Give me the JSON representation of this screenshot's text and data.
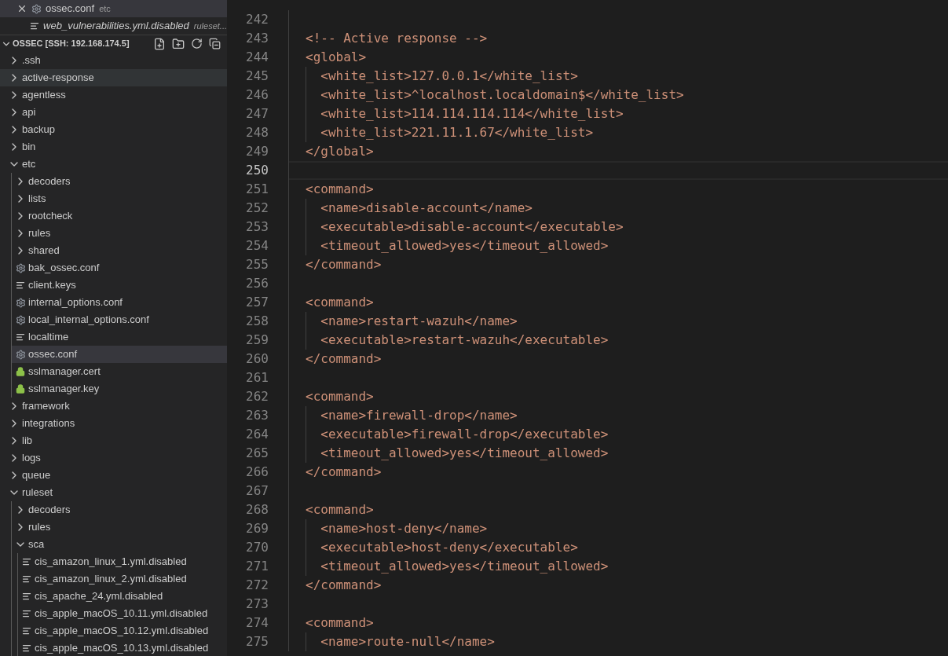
{
  "open_editors": [
    {
      "name": "ossec.conf",
      "description": "etc",
      "kind": "config",
      "selected": true,
      "preview": false,
      "closable": true
    },
    {
      "name": "web_vulnerabilities.yml.disabled",
      "description": "ruleset...",
      "kind": "text",
      "selected": false,
      "preview": true,
      "closable": false
    }
  ],
  "explorer": {
    "title": "OSSEC [SSH: 192.168.174.5]",
    "expanded": true,
    "items": [
      {
        "label": ".ssh",
        "kind": "folder",
        "expanded": false,
        "selected": false,
        "hovered": false
      },
      {
        "label": "active-response",
        "kind": "folder",
        "expanded": false,
        "selected": false,
        "hovered": true
      },
      {
        "label": "agentless",
        "kind": "folder",
        "expanded": false,
        "selected": false,
        "hovered": false
      },
      {
        "label": "api",
        "kind": "folder",
        "expanded": false,
        "selected": false,
        "hovered": false
      },
      {
        "label": "backup",
        "kind": "folder",
        "expanded": false,
        "selected": false,
        "hovered": false
      },
      {
        "label": "bin",
        "kind": "folder",
        "expanded": false,
        "selected": false,
        "hovered": false
      },
      {
        "label": "etc",
        "kind": "folder",
        "expanded": true,
        "selected": false,
        "hovered": false,
        "children": [
          {
            "label": "decoders",
            "kind": "folder",
            "expanded": false,
            "selected": false,
            "hovered": false
          },
          {
            "label": "lists",
            "kind": "folder",
            "expanded": false,
            "selected": false,
            "hovered": false
          },
          {
            "label": "rootcheck",
            "kind": "folder",
            "expanded": false,
            "selected": false,
            "hovered": false
          },
          {
            "label": "rules",
            "kind": "folder",
            "expanded": false,
            "selected": false,
            "hovered": false
          },
          {
            "label": "shared",
            "kind": "folder",
            "expanded": false,
            "selected": false,
            "hovered": false
          },
          {
            "label": "bak_ossec.conf",
            "kind": "config",
            "selected": false,
            "hovered": false
          },
          {
            "label": "client.keys",
            "kind": "text",
            "selected": false,
            "hovered": false
          },
          {
            "label": "internal_options.conf",
            "kind": "config",
            "selected": false,
            "hovered": false
          },
          {
            "label": "local_internal_options.conf",
            "kind": "config",
            "selected": false,
            "hovered": false
          },
          {
            "label": "localtime",
            "kind": "text",
            "selected": false,
            "hovered": false
          },
          {
            "label": "ossec.conf",
            "kind": "config",
            "selected": true,
            "hovered": false
          },
          {
            "label": "sslmanager.cert",
            "kind": "secure",
            "selected": false,
            "hovered": false
          },
          {
            "label": "sslmanager.key",
            "kind": "secure",
            "selected": false,
            "hovered": false
          }
        ]
      },
      {
        "label": "framework",
        "kind": "folder",
        "expanded": false,
        "selected": false,
        "hovered": false
      },
      {
        "label": "integrations",
        "kind": "folder",
        "expanded": false,
        "selected": false,
        "hovered": false
      },
      {
        "label": "lib",
        "kind": "folder",
        "expanded": false,
        "selected": false,
        "hovered": false
      },
      {
        "label": "logs",
        "kind": "folder",
        "expanded": false,
        "selected": false,
        "hovered": false
      },
      {
        "label": "queue",
        "kind": "folder",
        "expanded": false,
        "selected": false,
        "hovered": false
      },
      {
        "label": "ruleset",
        "kind": "folder",
        "expanded": true,
        "selected": false,
        "hovered": false,
        "children": [
          {
            "label": "decoders",
            "kind": "folder",
            "expanded": false,
            "selected": false,
            "hovered": false
          },
          {
            "label": "rules",
            "kind": "folder",
            "expanded": false,
            "selected": false,
            "hovered": false
          },
          {
            "label": "sca",
            "kind": "folder",
            "expanded": true,
            "selected": false,
            "hovered": false,
            "children": [
              {
                "label": "cis_amazon_linux_1.yml.disabled",
                "kind": "text",
                "selected": false,
                "hovered": false
              },
              {
                "label": "cis_amazon_linux_2.yml.disabled",
                "kind": "text",
                "selected": false,
                "hovered": false
              },
              {
                "label": "cis_apache_24.yml.disabled",
                "kind": "text",
                "selected": false,
                "hovered": false
              },
              {
                "label": "cis_apple_macOS_10.11.yml.disabled",
                "kind": "text",
                "selected": false,
                "hovered": false
              },
              {
                "label": "cis_apple_macOS_10.12.yml.disabled",
                "kind": "text",
                "selected": false,
                "hovered": false
              },
              {
                "label": "cis_apple_macOS_10.13.yml.disabled",
                "kind": "text",
                "selected": false,
                "hovered": false
              }
            ]
          }
        ]
      }
    ]
  },
  "editor": {
    "lines": [
      {
        "number": "242",
        "current": false
      },
      {
        "number": "243",
        "text": "<!-- Active response -->",
        "current": false
      },
      {
        "number": "244",
        "text": "<global>",
        "current": false
      },
      {
        "number": "245",
        "text": "  <white_list>127.0.0.1</white_list>",
        "current": false
      },
      {
        "number": "246",
        "text": "  <white_list>^localhost.localdomain$</white_list>",
        "current": false
      },
      {
        "number": "247",
        "text": "  <white_list>114.114.114.114</white_list>",
        "current": false
      },
      {
        "number": "248",
        "text": "  <white_list>221.11.1.67</white_list>",
        "current": false
      },
      {
        "number": "249",
        "text": "</global>",
        "current": false
      },
      {
        "number": "250",
        "current": true
      },
      {
        "number": "251",
        "text": "<command>",
        "current": false
      },
      {
        "number": "252",
        "text": "  <name>disable-account</name>",
        "current": false
      },
      {
        "number": "253",
        "text": "  <executable>disable-account</executable>",
        "current": false
      },
      {
        "number": "254",
        "text": "  <timeout_allowed>yes</timeout_allowed>",
        "current": false
      },
      {
        "number": "255",
        "text": "</command>",
        "current": false
      },
      {
        "number": "256",
        "current": false
      },
      {
        "number": "257",
        "text": "<command>",
        "current": false
      },
      {
        "number": "258",
        "text": "  <name>restart-wazuh</name>",
        "current": false
      },
      {
        "number": "259",
        "text": "  <executable>restart-wazuh</executable>",
        "current": false
      },
      {
        "number": "260",
        "text": "</command>",
        "current": false
      },
      {
        "number": "261",
        "current": false
      },
      {
        "number": "262",
        "text": "<command>",
        "current": false
      },
      {
        "number": "263",
        "text": "  <name>firewall-drop</name>",
        "current": false
      },
      {
        "number": "264",
        "text": "  <executable>firewall-drop</executable>",
        "current": false
      },
      {
        "number": "265",
        "text": "  <timeout_allowed>yes</timeout_allowed>",
        "current": false
      },
      {
        "number": "266",
        "text": "</command>",
        "current": false
      },
      {
        "number": "267",
        "current": false
      },
      {
        "number": "268",
        "text": "<command>",
        "current": false
      },
      {
        "number": "269",
        "text": "  <name>host-deny</name>",
        "current": false
      },
      {
        "number": "270",
        "text": "  <executable>host-deny</executable>",
        "current": false
      },
      {
        "number": "271",
        "text": "  <timeout_allowed>yes</timeout_allowed>",
        "current": false
      },
      {
        "number": "272",
        "text": "</command>",
        "current": false
      },
      {
        "number": "273",
        "current": false
      },
      {
        "number": "274",
        "text": "<command>",
        "current": false
      },
      {
        "number": "275",
        "text": "  <name>route-null</name>",
        "current": false
      }
    ]
  }
}
